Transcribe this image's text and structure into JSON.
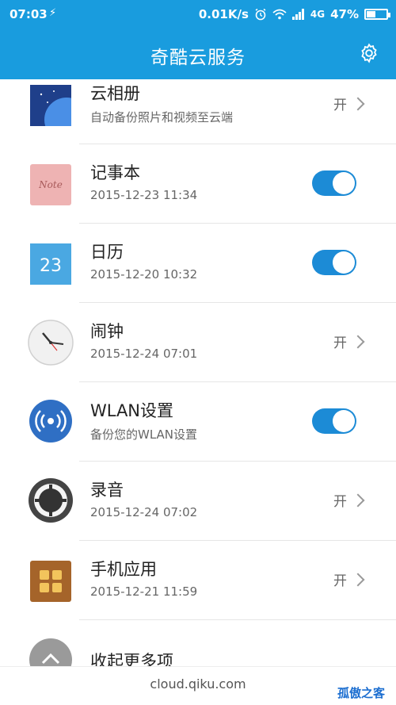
{
  "status_bar": {
    "time": "07:03",
    "usb_icon": "usb-icon",
    "network_speed": "0.01K/s",
    "network_type": "4G",
    "battery": "47%",
    "battery_level": 0.47
  },
  "header": {
    "title": "奇酷云服务",
    "settings_icon": "gear-icon"
  },
  "items": [
    {
      "title": "云相册",
      "subtitle": "自动备份照片和视频至云端",
      "control": "arrow",
      "status": "开"
    },
    {
      "title": "记事本",
      "subtitle": "2015-12-23 11:34",
      "control": "toggle",
      "on": true
    },
    {
      "title": "日历",
      "subtitle": "2015-12-20 10:32",
      "control": "toggle",
      "on": true,
      "icon_text": "23"
    },
    {
      "title": "闹钟",
      "subtitle": "2015-12-24 07:01",
      "control": "arrow",
      "status": "开"
    },
    {
      "title": "WLAN设置",
      "subtitle": "备份您的WLAN设置",
      "control": "toggle",
      "on": true
    },
    {
      "title": "录音",
      "subtitle": "2015-12-24 07:02",
      "control": "arrow",
      "status": "开"
    },
    {
      "title": "手机应用",
      "subtitle": "2015-12-21 11:59",
      "control": "arrow",
      "status": "开"
    },
    {
      "title": "收起更多项"
    }
  ],
  "note_icon_text": "Note",
  "footer": {
    "url": "cloud.qiku.com",
    "watermark": "孤傲之客"
  },
  "colors": {
    "primary": "#199cde",
    "toggle_on": "#1c8bd6"
  }
}
